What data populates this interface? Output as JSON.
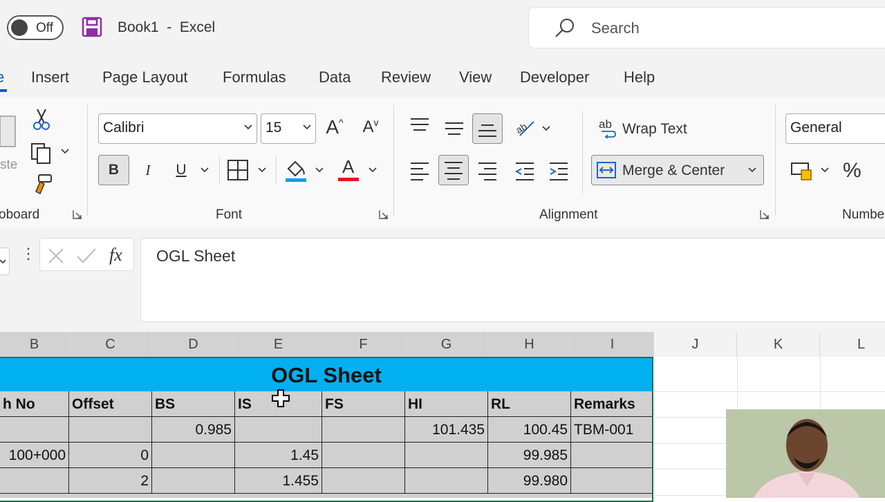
{
  "titlebar": {
    "autosave_label": "Off",
    "document_title": "Book1  -  Excel",
    "search_placeholder": "Search"
  },
  "tabs": [
    {
      "id": "home",
      "label": "e"
    },
    {
      "id": "insert",
      "label": "Insert"
    },
    {
      "id": "page-layout",
      "label": "Page Layout"
    },
    {
      "id": "formulas",
      "label": "Formulas"
    },
    {
      "id": "data",
      "label": "Data"
    },
    {
      "id": "review",
      "label": "Review"
    },
    {
      "id": "view",
      "label": "View"
    },
    {
      "id": "developer",
      "label": "Developer"
    },
    {
      "id": "help",
      "label": "Help"
    }
  ],
  "ribbon": {
    "clipboard": {
      "label": "oboard",
      "paste_label": "ste"
    },
    "font": {
      "label": "Font",
      "font_name": "Calibri",
      "font_size": "15",
      "bold": "B",
      "italic": "I",
      "underline": "U",
      "grow": "A",
      "shrink": "A",
      "font_color_letter": "A",
      "highlight_color": "#00a2e8",
      "font_color": "#e81123"
    },
    "alignment": {
      "label": "Alignment",
      "wrap_text": "Wrap Text",
      "merge_center": "Merge & Center",
      "wrap_icon_text": "ab"
    },
    "number": {
      "label": "Numbe",
      "format": "General",
      "percent": "%"
    }
  },
  "formula_bar": {
    "fx_label": "fx",
    "value": "OGL Sheet"
  },
  "columns": [
    "B",
    "C",
    "D",
    "E",
    "F",
    "G",
    "H",
    "I",
    "J",
    "K",
    "L"
  ],
  "sheet": {
    "title": "OGL Sheet",
    "title_fill": "#00b0f0",
    "table_fill": "#d0d0d0",
    "headers": [
      "h No",
      "Offset",
      "BS",
      "IS",
      "FS",
      "HI",
      "RL",
      "Remarks"
    ],
    "rows": [
      [
        "",
        "",
        "0.985",
        "",
        "",
        "101.435",
        "100.45",
        "TBM-001"
      ],
      [
        "100+000",
        "0",
        "",
        "1.45",
        "",
        "",
        "99.985",
        ""
      ],
      [
        "",
        "2",
        "",
        "1.455",
        "",
        "",
        "99.980",
        ""
      ]
    ]
  },
  "icons": {
    "save": "save-icon",
    "search": "search-icon",
    "cut": "scissors-icon",
    "copy": "copy-icon",
    "format_painter": "format-painter-icon",
    "borders": "borders-icon",
    "fill": "fill-color-icon",
    "orientation": "orientation-icon",
    "cell_styles": "cell-styles-icon"
  }
}
